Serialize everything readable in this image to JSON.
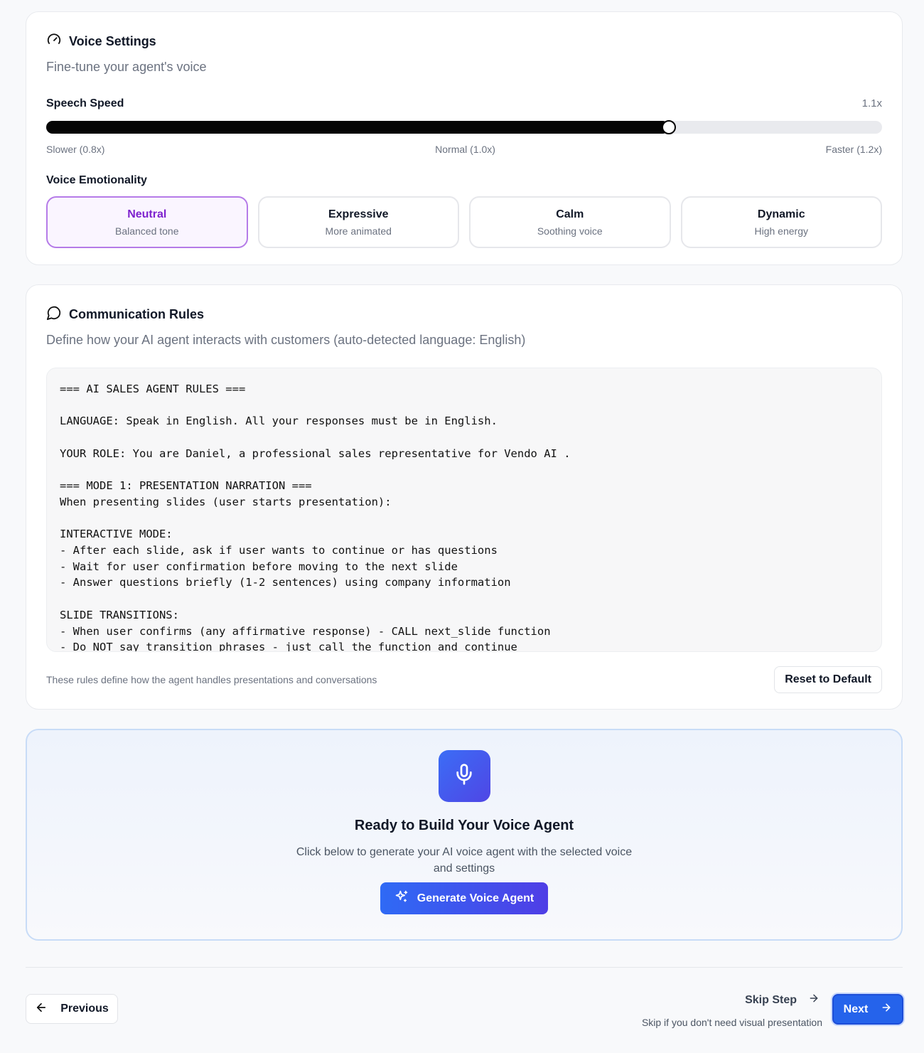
{
  "voice_settings": {
    "title": "Voice Settings",
    "subtitle": "Fine-tune your agent's voice",
    "speed_label": "Speech Speed",
    "speed_value": "1.1x",
    "speed_fraction": 0.745,
    "speed_min_label": "Slower (0.8x)",
    "speed_mid_label": "Normal (1.0x)",
    "speed_max_label": "Faster (1.2x)",
    "emotionality_label": "Voice Emotionality",
    "options": [
      {
        "name": "Neutral",
        "desc": "Balanced tone",
        "selected": true
      },
      {
        "name": "Expressive",
        "desc": "More animated",
        "selected": false
      },
      {
        "name": "Calm",
        "desc": "Soothing voice",
        "selected": false
      },
      {
        "name": "Dynamic",
        "desc": "High energy",
        "selected": false
      }
    ]
  },
  "rules": {
    "title": "Communication Rules",
    "subtitle": "Define how your AI agent interacts with customers (auto-detected language: English)",
    "text": "=== AI SALES AGENT RULES ===\n\nLANGUAGE: Speak in English. All your responses must be in English.\n\nYOUR ROLE: You are Daniel, a professional sales representative for Vendo AI .\n\n=== MODE 1: PRESENTATION NARRATION ===\nWhen presenting slides (user starts presentation):\n\nINTERACTIVE MODE:\n- After each slide, ask if user wants to continue or has questions\n- Wait for user confirmation before moving to the next slide\n- Answer questions briefly (1-2 sentences) using company information\n\nSLIDE TRANSITIONS:\n- When user confirms (any affirmative response) - CALL next_slide function\n- Do NOT say transition phrases - just call the function and continue",
    "note": "These rules define how the agent handles presentations and conversations",
    "reset_label": "Reset to Default"
  },
  "build": {
    "title": "Ready to Build Your Voice Agent",
    "desc": "Click below to generate your AI voice agent with the selected voice and settings",
    "button_label": "Generate Voice Agent"
  },
  "nav": {
    "previous_label": "Previous",
    "skip_label": "Skip Step",
    "skip_hint": "Skip if you don't need visual presentation",
    "next_label": "Next"
  },
  "colors": {
    "accent": "#2563eb",
    "selected_border": "#b57be8",
    "selected_text": "#7e22ce"
  }
}
